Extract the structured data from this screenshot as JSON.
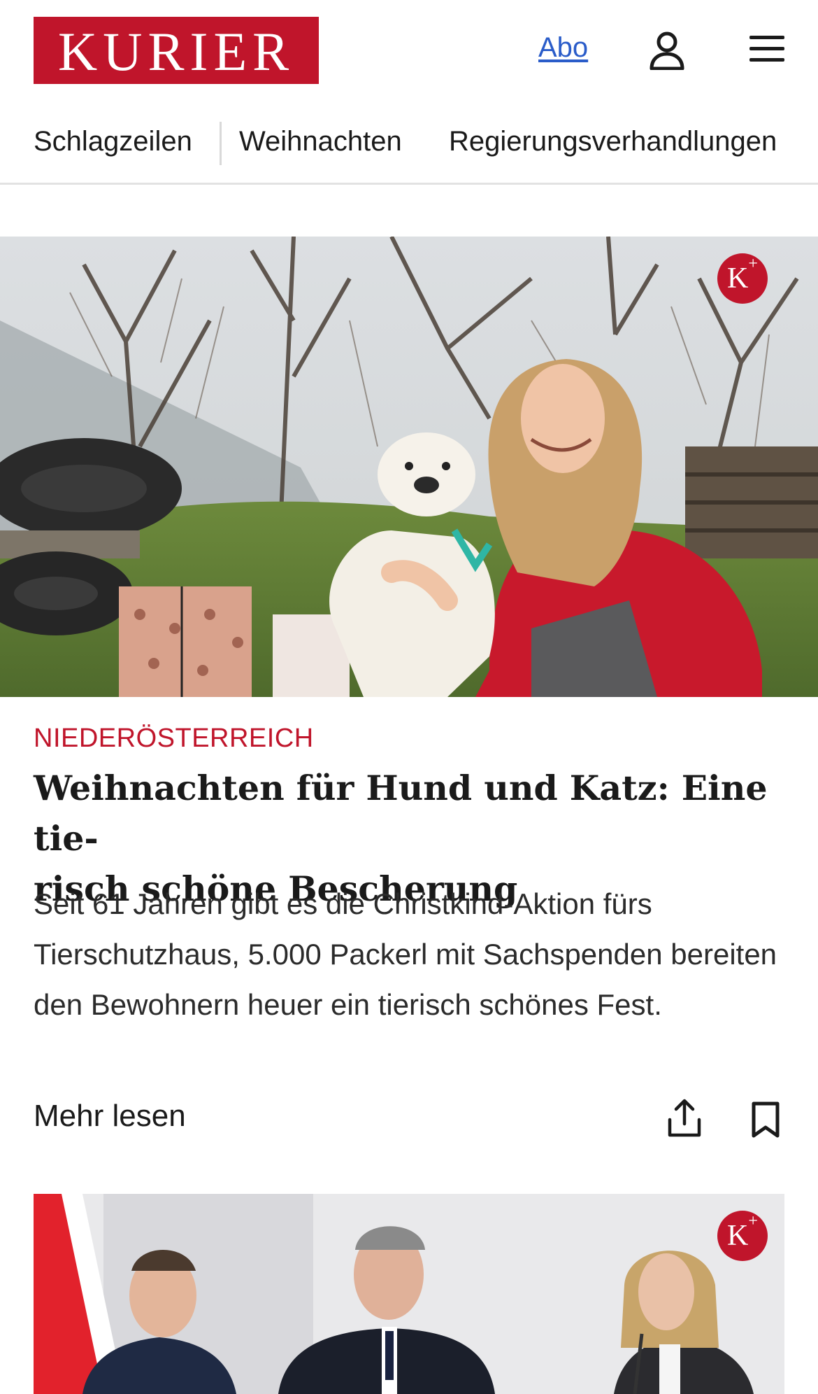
{
  "header": {
    "logo_text": "KURIER",
    "abo_label": "Abo",
    "user_icon": "user-icon",
    "menu_icon": "menu-icon"
  },
  "nav": {
    "items": [
      {
        "label": "Schlagzeilen"
      },
      {
        "label": "Weihnachten"
      },
      {
        "label": "Regierungsverhandlungen"
      }
    ]
  },
  "articles": [
    {
      "badge": "K+",
      "category": "NIEDERÖSTERREICH",
      "headline_line1": "Weihnachten für Hund und Katz: Eine tie-",
      "headline_line2": "risch schöne Bescherung",
      "teaser": "Seit 61 Jahren gibt es die Christkind-Aktion fürs Tierschutzhaus, 5.000 Packerl mit Sachspenden bereiten den Bewohnern heuer ein tierisch schönes Fest.",
      "more_label": "Mehr lesen",
      "share_icon": "share-icon",
      "bookmark_icon": "bookmark-icon"
    },
    {
      "badge": "K+"
    }
  ],
  "colors": {
    "brand": "#c0152b",
    "link": "#2a5cc9",
    "text": "#1a1a1a"
  }
}
